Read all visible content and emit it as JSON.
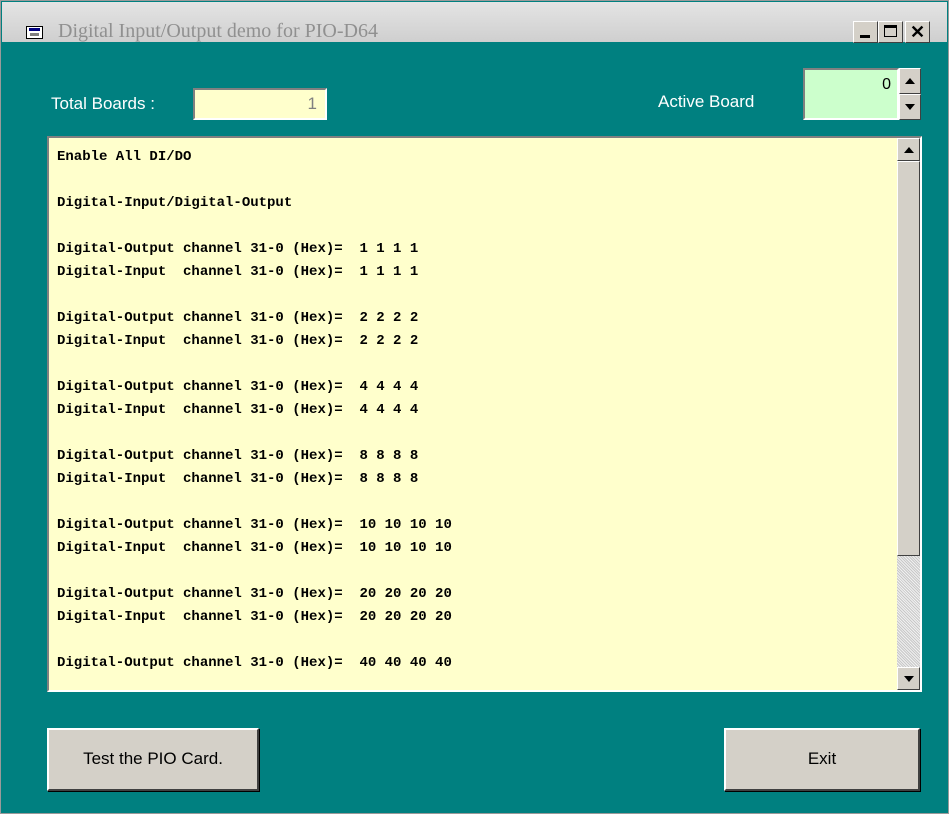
{
  "window": {
    "title": "Digital Input/Output demo for PIO-D64",
    "caption_buttons": [
      "minimize-icon",
      "maximize-icon",
      "close-icon"
    ]
  },
  "header": {
    "total_boards_label": "Total Boards :",
    "total_boards_value": "1",
    "active_board_label": "Active Board",
    "active_board_value": "0"
  },
  "log": {
    "lines": [
      "Enable All DI/DO",
      "",
      "Digital-Input/Digital-Output",
      "",
      "Digital-Output channel 31-0 (Hex)=  1 1 1 1",
      "Digital-Input  channel 31-0 (Hex)=  1 1 1 1",
      "",
      "Digital-Output channel 31-0 (Hex)=  2 2 2 2",
      "Digital-Input  channel 31-0 (Hex)=  2 2 2 2",
      "",
      "Digital-Output channel 31-0 (Hex)=  4 4 4 4",
      "Digital-Input  channel 31-0 (Hex)=  4 4 4 4",
      "",
      "Digital-Output channel 31-0 (Hex)=  8 8 8 8",
      "Digital-Input  channel 31-0 (Hex)=  8 8 8 8",
      "",
      "Digital-Output channel 31-0 (Hex)=  10 10 10 10",
      "Digital-Input  channel 31-0 (Hex)=  10 10 10 10",
      "",
      "Digital-Output channel 31-0 (Hex)=  20 20 20 20",
      "Digital-Input  channel 31-0 (Hex)=  20 20 20 20",
      "",
      "Digital-Output channel 31-0 (Hex)=  40 40 40 40"
    ]
  },
  "buttons": {
    "test_label": "Test the PIO Card.",
    "exit_label": "Exit"
  },
  "colors": {
    "form_background": "#008080",
    "field_background": "#ffffcc",
    "active_board_background": "#ccffcc"
  }
}
